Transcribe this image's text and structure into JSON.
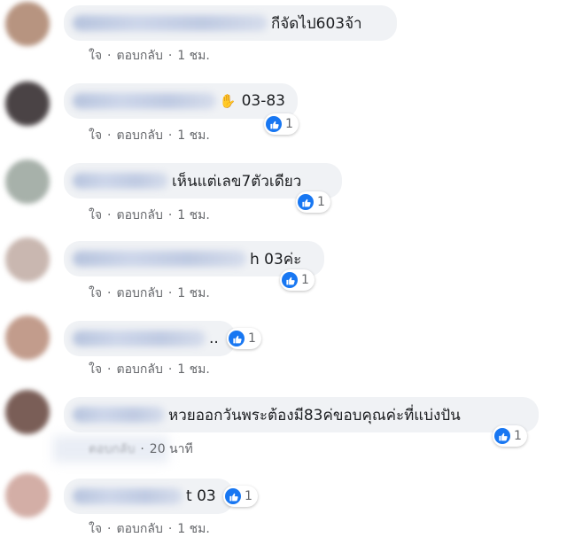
{
  "comments": [
    {
      "avatar_color": "#b79480",
      "text": "กีจัดไป603จ้า",
      "like": "ใจ",
      "reply": "ตอบกลับ",
      "time": "1 ชม.",
      "reactions": ""
    },
    {
      "avatar_color": "#4a4345",
      "text": "03-83",
      "like": "ใจ",
      "reply": "ตอบกลับ",
      "time": "1 ชม.",
      "reactions": "1"
    },
    {
      "avatar_color": "#a7b1aa",
      "text": "เห็นแต่เลข7ตัวเดียว",
      "like": "ใจ",
      "reply": "ตอบกลับ",
      "time": "1 ชม.",
      "reactions": "1"
    },
    {
      "avatar_color": "#c9b7b0",
      "text": "h 03ค่ะ",
      "like": "ใจ",
      "reply": "ตอบกลับ",
      "time": "1 ชม.",
      "reactions": "1"
    },
    {
      "avatar_color": "#c29c8c",
      "text": "..",
      "like": "ใจ",
      "reply": "ตอบกลับ",
      "time": "1 ชม.",
      "reactions": "1"
    },
    {
      "avatar_color": "#7a5e57",
      "text": "หวยออกวันพระต้องมี83ค่ขอบคุณค่ะที่แบ่งปัน",
      "like": "",
      "reply": "ตอบกลับ",
      "time": "20 นาที",
      "reactions": "1"
    },
    {
      "avatar_color": "#d3aea6",
      "text": "t 03",
      "like": "ใจ",
      "reply": "ตอบกลับ",
      "time": "1 ชม.",
      "reactions": "1"
    }
  ],
  "separator": "·",
  "icons": {
    "like": "like-thumb-icon",
    "wave": "wave-hand-icon",
    "wave_glyph": "✋"
  }
}
